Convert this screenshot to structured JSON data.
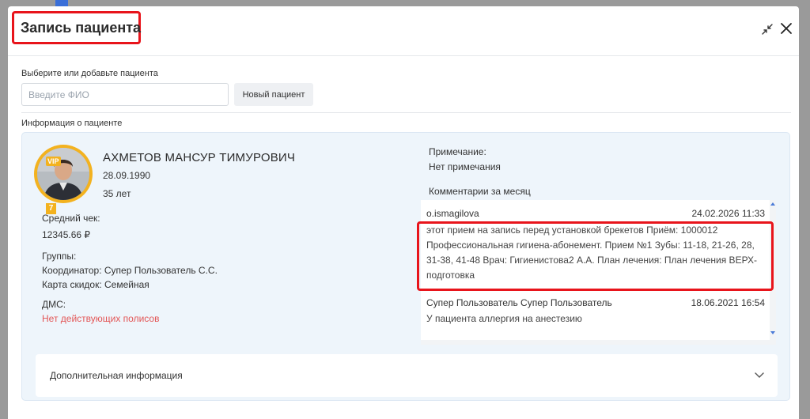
{
  "modal": {
    "title": "Запись пациента",
    "choose_label": "Выберите или добавьте пациента",
    "fio_placeholder": "Введите ФИО",
    "new_patient_label": "Новый пациент",
    "info_label": "Информация о пациенте"
  },
  "patient": {
    "vip": "VIP",
    "level": "7",
    "name": "АХМЕТОВ МАНСУР ТИМУРОВИЧ",
    "dob": "28.09.1990",
    "age": "35 лет",
    "avg_check_label": "Средний чек:",
    "avg_check_value": "12345.66 ₽",
    "groups_label": "Группы:",
    "coordinator": "Координатор: Супер Пользователь С.С.",
    "discount_card": "Карта скидок: Семейная",
    "dms_label": "ДМС:",
    "dms_value": "Нет действующих полисов",
    "note_label": "Примечание:",
    "note_value": "Нет примечания",
    "comments_label": "Комментарии за месяц",
    "comments": [
      {
        "author": "o.ismagilova",
        "time": "24.02.2026 11:33",
        "text": "этот прием на запись перед установкой брекетов Приём: 1000012 Профессиональная гигиена-абонемент. Прием №1 Зубы: 11-18, 21-26, 28, 31-38, 41-48 Врач: Гигиенистова2 А.А. План лечения: План лечения ВЕРХ-подготовка"
      },
      {
        "author": "Супер Пользователь Супер Пользователь",
        "time": "18.06.2021 16:54",
        "text": "У пациента аллергия на анестезию"
      }
    ],
    "extra_info_label": "Дополнительная информация"
  },
  "colors": {
    "accent_red": "#e8141b",
    "panel_bg": "#eef5fb",
    "vip_gold": "#f3b21f",
    "warning_text": "#e35656"
  },
  "icons": [
    "collapse-icon",
    "close-icon",
    "chevron-down-icon"
  ]
}
